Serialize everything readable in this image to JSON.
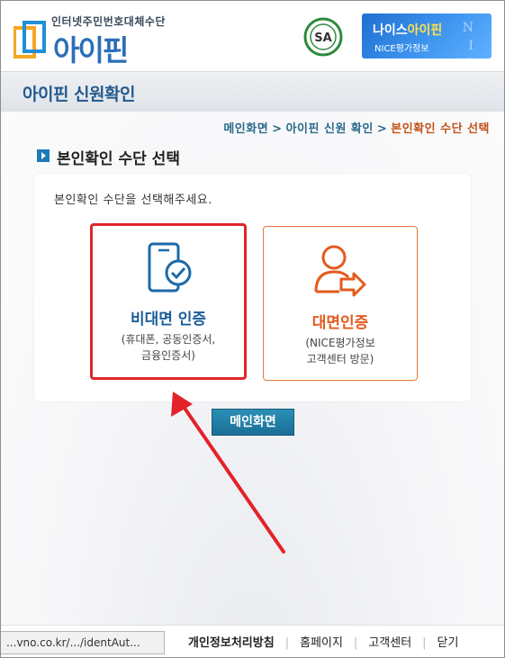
{
  "header": {
    "logo_sub": "인터넷주민번호대체수단",
    "logo_main": "아이핀",
    "sa_badge": "SA",
    "nice_title_a": "나이스",
    "nice_title_b": "아이핀",
    "nice_sub": "NICE평가정보",
    "nice_letters": "N I C E"
  },
  "page": {
    "title": "아이핀 신원확인"
  },
  "breadcrumb": {
    "items": [
      "메인화면",
      "아이핀 신원 확인",
      "본인확인 수단 선택"
    ],
    "separator": ">"
  },
  "section": {
    "title": "본인확인 수단 선택",
    "instruction": "본인확인 수단을 선택해주세요."
  },
  "options": [
    {
      "label": "비대면 인증",
      "desc_line1": "(휴대폰, 공동인증서,",
      "desc_line2": "금융인증서)"
    },
    {
      "label": "대면인증",
      "desc_line1": "(NICE평가정보",
      "desc_line2": "고객센터 방문)"
    }
  ],
  "main_button": "메인화면",
  "footer": {
    "links": [
      "개인정보처리방침",
      "홈페이지",
      "고객센터",
      "닫기"
    ]
  },
  "status_url": "...vno.co.kr/.../identAut...",
  "colors": {
    "accent_blue": "#1c5c9a",
    "accent_orange": "#e35b1d",
    "highlight_red": "#e0262b"
  }
}
